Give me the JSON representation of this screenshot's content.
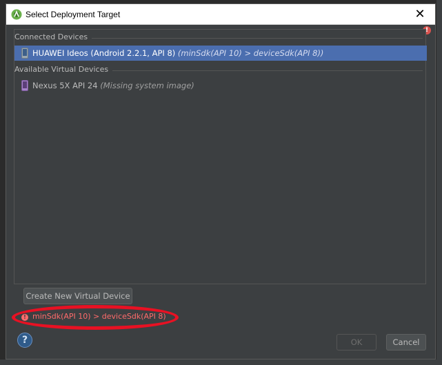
{
  "window": {
    "title": "Select Deployment Target",
    "close_glyph": "✕"
  },
  "sections": {
    "connected": "Connected Devices",
    "virtual": "Available Virtual Devices"
  },
  "devices": {
    "connected": [
      {
        "name": "HUAWEI Ideos (Android 2.2.1, API 8)",
        "note": "(minSdk(API 10) > deviceSdk(API 8))",
        "selected": true
      }
    ],
    "virtual": [
      {
        "name": "Nexus 5X API 24",
        "note": "(Missing system image)",
        "selected": false
      }
    ]
  },
  "buttons": {
    "create": "Create New Virtual Device",
    "ok": "OK",
    "cancel": "Cancel",
    "help": "?"
  },
  "error": {
    "message": "minSdk(API 10) > deviceSdk(API 8)",
    "glyph": "!"
  },
  "colors": {
    "selection": "#4b6eaf",
    "error_text": "#ff6b6b",
    "highlight_ellipse": "#e81123",
    "dialog_bg": "#3c3f41"
  }
}
